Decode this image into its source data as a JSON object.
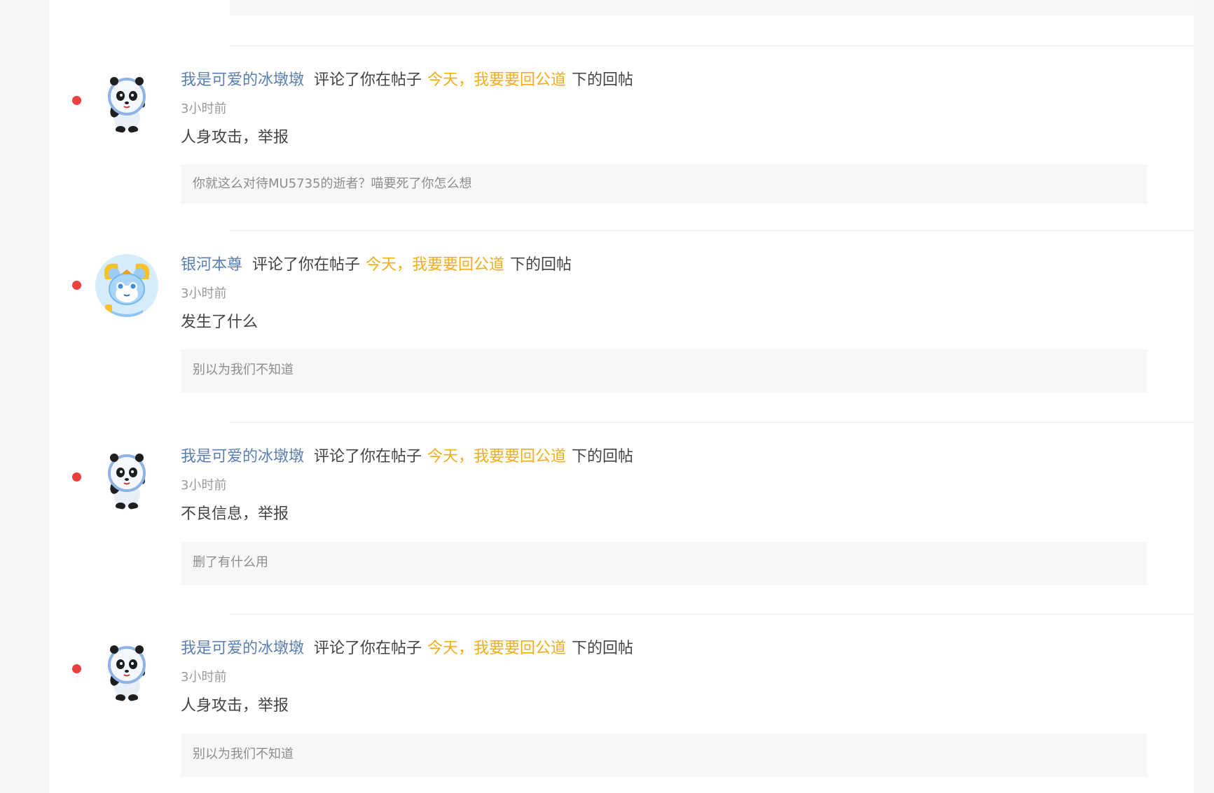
{
  "notifications": [
    {
      "username": "我是可爱的冰墩墩",
      "action": "评论了你在帖子",
      "post_title": "今天，我要要回公道",
      "suffix": "下的回帖",
      "time": "3小时前",
      "reply": "人身攻击，举报",
      "quoted": "你就这么对待MU5735的逝者？喵要死了你怎么想",
      "avatar": "bing-dwen-dwen-avatar"
    },
    {
      "username": "银河本尊",
      "action": "评论了你在帖子",
      "post_title": "今天，我要要回公道",
      "suffix": "下的回帖",
      "time": "3小时前",
      "reply": "发生了什么",
      "quoted": "别以为我们不知道",
      "avatar": "shuey-rhon-rhon-avatar"
    },
    {
      "username": "我是可爱的冰墩墩",
      "action": "评论了你在帖子",
      "post_title": "今天，我要要回公道",
      "suffix": "下的回帖",
      "time": "3小时前",
      "reply": "不良信息，举报",
      "quoted": "删了有什么用",
      "avatar": "bing-dwen-dwen-avatar"
    },
    {
      "username": "我是可爱的冰墩墩",
      "action": "评论了你在帖子",
      "post_title": "今天，我要要回公道",
      "suffix": "下的回帖",
      "time": "3小时前",
      "reply": "人身攻击，举报",
      "quoted": "别以为我们不知道",
      "avatar": "bing-dwen-dwen-avatar"
    }
  ],
  "colors": {
    "unread_dot": "#ea3f3f",
    "user_link": "#5b7fb3",
    "post_link": "#f2ad17"
  }
}
